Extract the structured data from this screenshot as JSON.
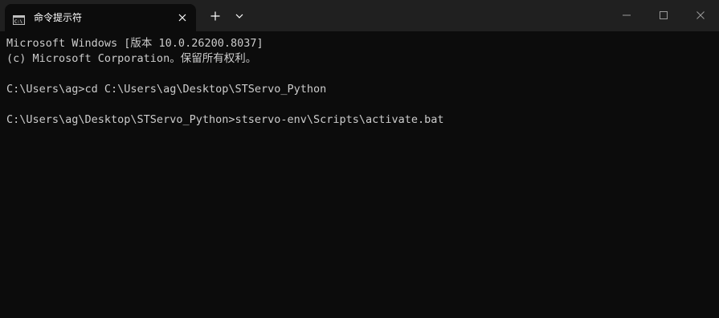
{
  "tab": {
    "title": "命令提示符",
    "icon": "cmd-icon"
  },
  "toolbar": {
    "new_tab_icon": "plus-icon",
    "dropdown_icon": "chevron-down-icon"
  },
  "window_controls": [
    "minimize-icon",
    "maximize-icon",
    "close-icon"
  ],
  "console": {
    "lines": [
      "Microsoft Windows [版本 10.0.26200.8037]",
      "(c) Microsoft Corporation。保留所有权利。",
      "",
      "C:\\Users\\ag>cd C:\\Users\\ag\\Desktop\\STServo_Python",
      "",
      "C:\\Users\\ag\\Desktop\\STServo_Python>stservo-env\\Scripts\\activate.bat"
    ]
  },
  "colors": {
    "background": "#0c0c0c",
    "titlebar": "#202020",
    "text": "#cccccc"
  }
}
